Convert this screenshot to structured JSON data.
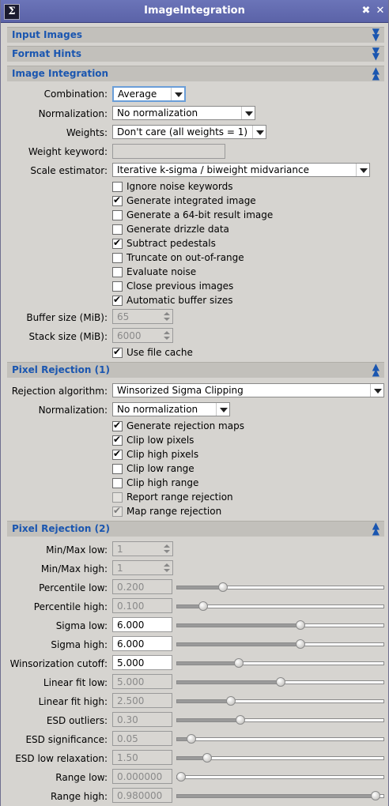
{
  "window": {
    "title": "ImageIntegration",
    "app_icon": "Σ",
    "btn_min": "✕",
    "btn_close": "✕",
    "btn_shade": "✖"
  },
  "sections": {
    "input_images": "Input Images",
    "format_hints": "Format Hints",
    "image_integration": "Image Integration",
    "pixel_rejection_1": "Pixel Rejection (1)",
    "pixel_rejection_2": "Pixel Rejection (2)"
  },
  "image_integration": {
    "combination": {
      "label": "Combination:",
      "value": "Average"
    },
    "normalization": {
      "label": "Normalization:",
      "value": "No normalization"
    },
    "weights": {
      "label": "Weights:",
      "value": "Don't care (all weights = 1)"
    },
    "weight_keyword": {
      "label": "Weight keyword:",
      "value": ""
    },
    "scale_estimator": {
      "label": "Scale estimator:",
      "value": "Iterative k-sigma / biweight midvariance"
    },
    "checks": [
      {
        "label": "Ignore noise keywords",
        "checked": false
      },
      {
        "label": "Generate integrated image",
        "checked": true
      },
      {
        "label": "Generate a 64-bit result image",
        "checked": false
      },
      {
        "label": "Generate drizzle data",
        "checked": false
      },
      {
        "label": "Subtract pedestals",
        "checked": true
      },
      {
        "label": "Truncate on out-of-range",
        "checked": false
      },
      {
        "label": "Evaluate noise",
        "checked": false
      },
      {
        "label": "Close previous images",
        "checked": false
      },
      {
        "label": "Automatic buffer sizes",
        "checked": true
      }
    ],
    "buffer_size": {
      "label": "Buffer size (MiB):",
      "value": "65"
    },
    "stack_size": {
      "label": "Stack size (MiB):",
      "value": "6000"
    },
    "use_file_cache": {
      "label": "Use file cache",
      "checked": true
    }
  },
  "pixel_rejection_1": {
    "algorithm": {
      "label": "Rejection algorithm:",
      "value": "Winsorized Sigma Clipping"
    },
    "normalization": {
      "label": "Normalization:",
      "value": "No normalization"
    },
    "checks": [
      {
        "label": "Generate rejection maps",
        "checked": true
      },
      {
        "label": "Clip low pixels",
        "checked": true
      },
      {
        "label": "Clip high pixels",
        "checked": true
      },
      {
        "label": "Clip low range",
        "checked": false
      },
      {
        "label": "Clip high range",
        "checked": false
      },
      {
        "label": "Report range rejection",
        "checked": false
      },
      {
        "label": "Map range rejection",
        "checked": true
      }
    ]
  },
  "pixel_rejection_2": {
    "minmax_low": {
      "label": "Min/Max low:",
      "value": "1"
    },
    "minmax_high": {
      "label": "Min/Max high:",
      "value": "1"
    },
    "params": [
      {
        "label": "Percentile low:",
        "value": "0.200",
        "enabled": false,
        "level": 0.21
      },
      {
        "label": "Percentile high:",
        "value": "0.100",
        "enabled": false,
        "level": 0.11
      },
      {
        "label": "Sigma low:",
        "value": "6.000",
        "enabled": true,
        "level": 0.6
      },
      {
        "label": "Sigma high:",
        "value": "6.000",
        "enabled": true,
        "level": 0.6
      },
      {
        "label": "Winsorization cutoff:",
        "value": "5.000",
        "enabled": true,
        "level": 0.29
      },
      {
        "label": "Linear fit low:",
        "value": "5.000",
        "enabled": false,
        "level": 0.5
      },
      {
        "label": "Linear fit high:",
        "value": "2.500",
        "enabled": false,
        "level": 0.25
      },
      {
        "label": "ESD outliers:",
        "value": "0.30",
        "enabled": false,
        "level": 0.3
      },
      {
        "label": "ESD significance:",
        "value": "0.05",
        "enabled": false,
        "level": 0.05
      },
      {
        "label": "ESD low relaxation:",
        "value": "1.50",
        "enabled": false,
        "level": 0.13
      },
      {
        "label": "Range low:",
        "value": "0.000000",
        "enabled": false,
        "level": 0.0
      },
      {
        "label": "Range high:",
        "value": "0.980000",
        "enabled": false,
        "level": 0.98
      }
    ]
  }
}
